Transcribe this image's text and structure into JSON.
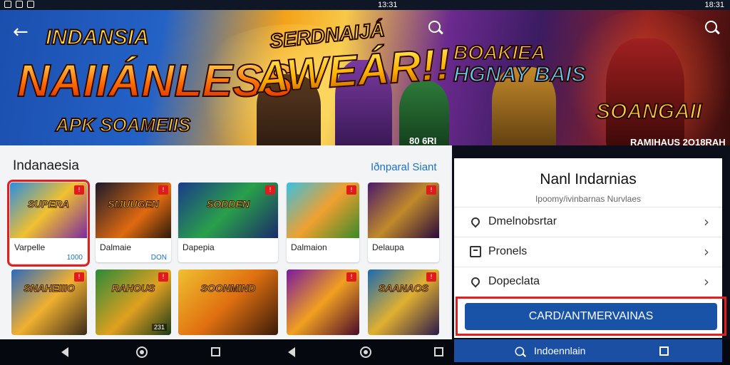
{
  "status_bar": {
    "left_time": "",
    "mid_time": "13:31",
    "right_time": "18:31"
  },
  "banner": {
    "title_small": "INDANSIA",
    "title_big": "NAIIÁNLESS",
    "subtitle": "APK SOAMEIIS",
    "headline_small": "SERDNAIJÁ",
    "headline_big": "AWEÁR!!",
    "logo_top": "BOAKIEA",
    "logo_bottom": "HGNAY BAIS",
    "logo_right": "SOANGAII",
    "caption_mid": "80 6RI",
    "caption_right": "RAMIHAUS 2O18RAH"
  },
  "section": {
    "title": "Indanaesia",
    "see_all": "Iðnparal Siant"
  },
  "cards": [
    {
      "title": "SUPERA",
      "name": "Varpelle",
      "meta_left": "",
      "meta_right": "1000",
      "badge": "!"
    },
    {
      "title": "SMUUGEN",
      "name": "Dalmaie",
      "meta_left": "",
      "meta_right": "DON",
      "badge": "!"
    },
    {
      "title": "SODDEN",
      "name": "Dapepia",
      "meta_left": "",
      "meta_right": "",
      "badge": "!"
    },
    {
      "title": "",
      "name": "Dalmaion",
      "meta_left": "",
      "meta_right": "",
      "badge": "!"
    },
    {
      "title": "",
      "name": "Delaupa",
      "meta_left": "",
      "meta_right": "",
      "badge": "!"
    }
  ],
  "tiles": [
    {
      "title": "SNAHEIIIO",
      "badge": "!",
      "tag": ""
    },
    {
      "title": "RAHOUS",
      "badge": "!",
      "tag": "231"
    },
    {
      "title": "SOONMIND",
      "badge": "",
      "tag": ""
    },
    {
      "title": "",
      "badge": "!",
      "tag": ""
    },
    {
      "title": "SAANAOS",
      "badge": "!",
      "tag": ""
    }
  ],
  "dialog": {
    "title": "Nanl Indarnias",
    "subtitle": "Ipoomy/ivinbarnas Nurvlaes",
    "items": [
      {
        "label": "Dmelnobsrtar"
      },
      {
        "label": "Pronels"
      },
      {
        "label": "Dopeclata"
      }
    ],
    "cta": "CARD/ANTMERVAINAS"
  },
  "bottom_search": {
    "label": "Indoennlain"
  },
  "icons": {
    "back": "arrow-left-icon",
    "search": "search-icon",
    "heart": "heart-icon",
    "card": "card-icon",
    "chevron": "chevron-right-icon"
  }
}
